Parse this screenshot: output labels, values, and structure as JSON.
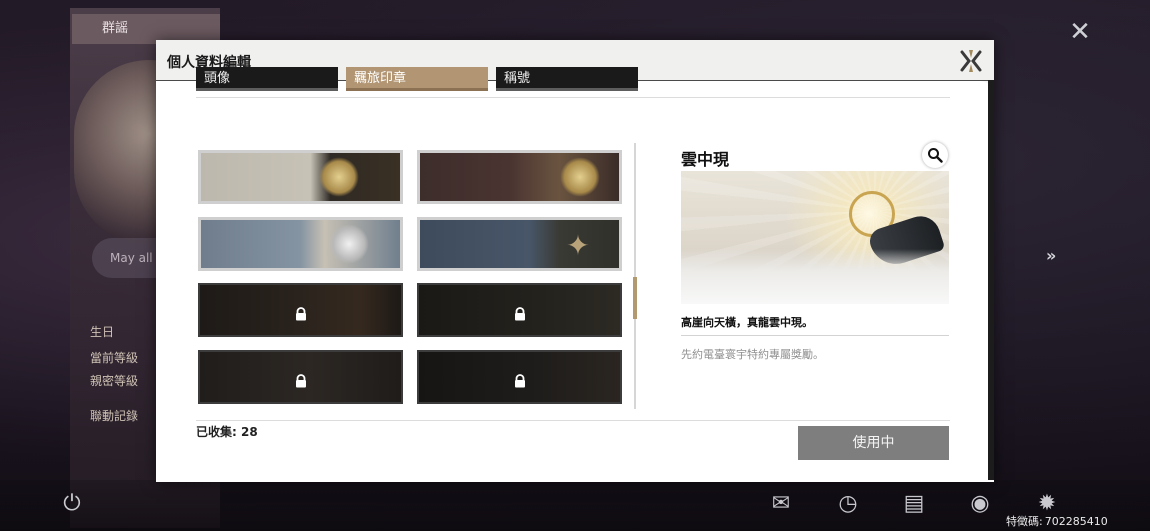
{
  "background": {
    "card_tag": "群謡",
    "motto_text": "May all",
    "info_lines": [
      "生日",
      "當前等級",
      "親密等級"
    ],
    "info_link": "聯動記錄",
    "uid_label": "特徵碼:",
    "uid_value": "702285410"
  },
  "dialog": {
    "title": "個人資料編輯"
  },
  "tabs": [
    {
      "label": "頭像",
      "active": false
    },
    {
      "label": "羈旅印章",
      "active": true
    },
    {
      "label": "稱號",
      "active": false
    }
  ],
  "stamps": [
    {
      "name": "stamp-1",
      "locked": false
    },
    {
      "name": "stamp-2",
      "locked": false
    },
    {
      "name": "stamp-3",
      "locked": false
    },
    {
      "name": "stamp-4",
      "locked": false
    },
    {
      "name": "stamp-5",
      "locked": true
    },
    {
      "name": "stamp-6",
      "locked": true
    },
    {
      "name": "stamp-7",
      "locked": true
    },
    {
      "name": "stamp-8",
      "locked": true
    }
  ],
  "collected": {
    "label": "已收集:",
    "count": "28"
  },
  "detail": {
    "title": "雲中現",
    "description": "高崖向天橫，真龍雲中現。",
    "source": "先約電臺寰宇特約專屬獎勵。",
    "button_label": "使用中"
  },
  "icons": {
    "dialog_close": "close-x-icon",
    "zoom": "magnifier-icon",
    "lock": "lock-icon",
    "bottom_bar": [
      "power-icon",
      "mail-icon",
      "clock-icon",
      "notice-icon",
      "camera-icon",
      "settings-icon"
    ]
  },
  "colors": {
    "active_tab": "#b29572",
    "tab_bg": "#1a1a1a",
    "use_button": "#7e7e7e",
    "scroll_thumb": "#b3996f"
  }
}
